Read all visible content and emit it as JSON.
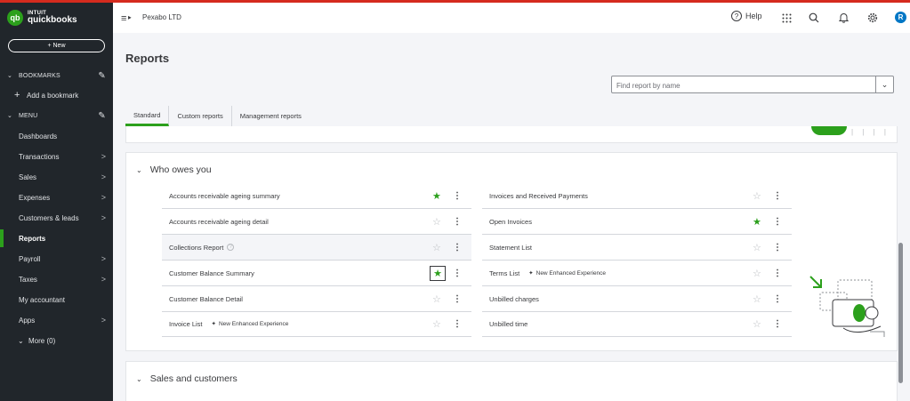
{
  "sidebar": {
    "logo_line1": "INTUIT",
    "logo_line2": "quickbooks",
    "logo_badge": "qb",
    "new_label": "+ New",
    "bookmarks_label": "BOOKMARKS",
    "add_bookmark_label": "Add a bookmark",
    "menu_label": "MENU",
    "items": [
      {
        "label": "Dashboards",
        "chevron": false
      },
      {
        "label": "Transactions",
        "chevron": true
      },
      {
        "label": "Sales",
        "chevron": true
      },
      {
        "label": "Expenses",
        "chevron": true
      },
      {
        "label": "Customers & leads",
        "chevron": true
      },
      {
        "label": "Reports",
        "chevron": false,
        "active": true
      },
      {
        "label": "Payroll",
        "chevron": true
      },
      {
        "label": "Taxes",
        "chevron": true
      },
      {
        "label": "My accountant",
        "chevron": false
      },
      {
        "label": "Apps",
        "chevron": true
      }
    ],
    "more_label": "More (0)"
  },
  "header": {
    "company": "Pexabo LTD",
    "help_label": "Help",
    "avatar_initial": "R"
  },
  "page": {
    "title": "Reports",
    "search_placeholder": "Find report by name",
    "tabs": [
      "Standard",
      "Custom reports",
      "Management reports"
    ]
  },
  "section_who_owes": {
    "title": "Who owes you",
    "left_reports": [
      {
        "name": "Accounts receivable ageing summary",
        "favorite": true
      },
      {
        "name": "Accounts receivable ageing detail",
        "favorite": false
      },
      {
        "name": "Collections Report",
        "favorite": false,
        "info": true
      },
      {
        "name": "Customer Balance Summary",
        "favorite": true,
        "focused": true
      },
      {
        "name": "Customer Balance Detail",
        "favorite": false
      },
      {
        "name": "Invoice List",
        "favorite": false,
        "tag": "New Enhanced Experience"
      }
    ],
    "right_reports": [
      {
        "name": "Invoices and Received Payments",
        "favorite": false
      },
      {
        "name": "Open Invoices",
        "favorite": true
      },
      {
        "name": "Statement List",
        "favorite": false
      },
      {
        "name": "Terms List",
        "favorite": false,
        "tag": "New Enhanced Experience"
      },
      {
        "name": "Unbilled charges",
        "favorite": false
      },
      {
        "name": "Unbilled time",
        "favorite": false
      }
    ]
  },
  "section_sales": {
    "title": "Sales and customers"
  },
  "colors": {
    "brand_green": "#2ca01c",
    "sidebar_bg": "#21262b",
    "top_accent": "#d52b1e"
  }
}
